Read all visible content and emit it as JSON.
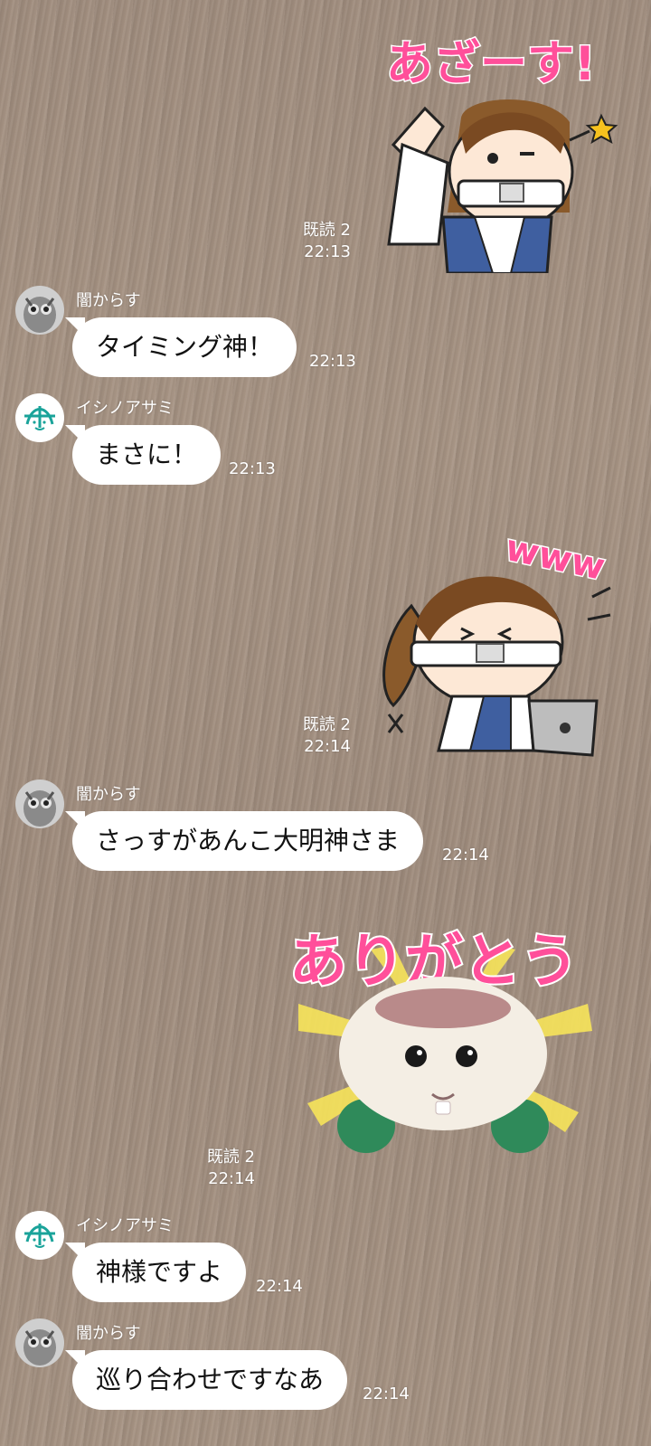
{
  "messages": [
    {
      "kind": "sticker_out",
      "read": "既読 2",
      "time": "22:13",
      "sticker_text": "あざーす!"
    },
    {
      "kind": "text_in",
      "sender": "闇からす",
      "avatar": "owl-avatar",
      "text": "タイミング神！",
      "time": "22:13"
    },
    {
      "kind": "text_in",
      "sender": "イシノアサミ",
      "avatar": "initial-logo-avatar",
      "text": "まさに！",
      "time": "22:13"
    },
    {
      "kind": "sticker_out",
      "read": "既読 2",
      "time": "22:14",
      "sticker_text": "www"
    },
    {
      "kind": "text_in",
      "sender": "闇からす",
      "avatar": "owl-avatar",
      "text": "さっすがあんこ大明神さま",
      "time": "22:14"
    },
    {
      "kind": "sticker_out",
      "read": "既読 2",
      "time": "22:14",
      "sticker_text": "ありがとう"
    },
    {
      "kind": "text_in",
      "sender": "イシノアサミ",
      "avatar": "initial-logo-avatar",
      "text": "神様ですよ",
      "time": "22:14"
    },
    {
      "kind": "text_in",
      "sender": "闇からす",
      "avatar": "owl-avatar",
      "text": "巡り合わせですなあ",
      "time": "22:14"
    }
  ],
  "colors": {
    "bubble": "#ffffff",
    "meta_text": "#ffffff",
    "sticker_pink": "#ff4f9a",
    "sticker_yellow": "#f7e45a"
  }
}
